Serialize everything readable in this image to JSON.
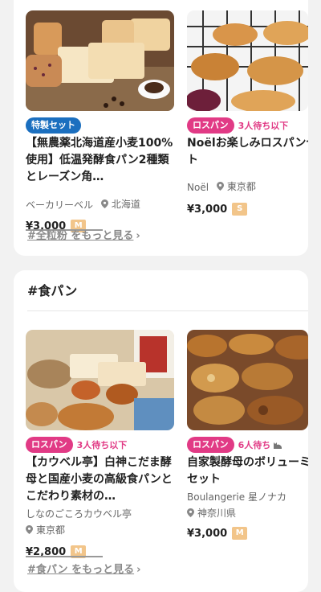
{
  "section1": {
    "cards": [
      {
        "badge": "特製セット",
        "badge_color": "#1b6fbf",
        "title_line1": "【無農薬北海道産小麦100%",
        "title_line2": "使用】低温発酵食パン2種類",
        "title_line3": "とレーズン角…",
        "shop": "ベーカリーベル",
        "location": "北海道",
        "price": "¥3,000",
        "size": "M"
      },
      {
        "badge": "ロスパン",
        "badge_color": "#e13a85",
        "wait": "3人待ち以下",
        "title_line1": "Noëlお楽しみロスパンセッ",
        "title_line2": "ト",
        "shop": "Noël",
        "location": "東京都",
        "price": "¥3,000",
        "size": "S"
      }
    ],
    "more_link": "#全粒粉 をもっと見る"
  },
  "section2": {
    "title": "#食パン",
    "cards": [
      {
        "badge": "ロスパン",
        "badge_color": "#e13a85",
        "wait": "3人待ち以下",
        "title_line1": "【カウベル亭】白神こだま酵",
        "title_line2": "母と国産小麦の高級食パンと",
        "title_line3": "こだわり素材の…",
        "shop": "しなのごころカウベル亭",
        "location": "東京都",
        "price": "¥2,800",
        "size": "M"
      },
      {
        "badge": "ロスパン",
        "badge_color": "#e13a85",
        "wait": "6人待ち",
        "wait_icon": "cat-icon",
        "title_line1": "自家製酵母のボリューミー",
        "title_line2": "セット",
        "shop": "Boulangerie 星ノナカ",
        "location": "神奈川県",
        "price": "¥3,000",
        "size": "M"
      }
    ],
    "more_link": "#食パン をもっと見る"
  }
}
